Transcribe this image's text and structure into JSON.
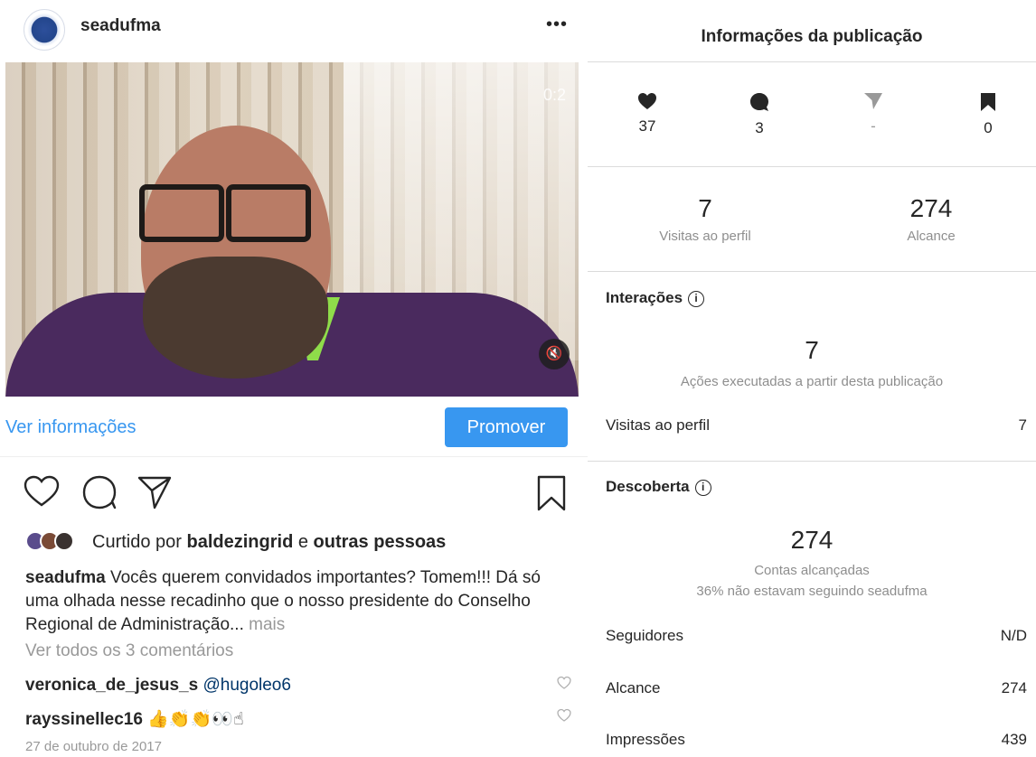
{
  "post": {
    "username": "seadufma",
    "more_label": "•••",
    "video_timer": "0:2",
    "mute_icon": "speaker-muted-icon",
    "view_info": "Ver informações",
    "promote": "Promover",
    "liked_prefix": "Curtido por ",
    "liked_user": "baldezingrid",
    "liked_mid": " e ",
    "liked_others": "outras pessoas",
    "caption_user": "seadufma",
    "caption_text": " Vocês querem convidados importantes? Tomem!!! Dá só uma olhada nesse recadinho que o nosso presidente do Conselho Regional de Administração...",
    "caption_more": " mais",
    "view_comments": "Ver todos os 3 comentários",
    "comments": [
      {
        "user": "veronica_de_jesus_s",
        "text": "@hugoleo6"
      },
      {
        "user": "rayssinellec16",
        "text": "👍👏👏👀☝"
      }
    ],
    "date": "27 de outubro de 2017"
  },
  "insights": {
    "title": "Informações da publicação",
    "stats": [
      {
        "icon": "heart-icon",
        "value": "37"
      },
      {
        "icon": "comment-icon",
        "value": "3"
      },
      {
        "icon": "share-icon",
        "value": "-"
      },
      {
        "icon": "bookmark-icon",
        "value": "0"
      }
    ],
    "profile_visits": {
      "value": "7",
      "label": "Visitas ao perfil"
    },
    "reach": {
      "value": "274",
      "label": "Alcance"
    },
    "interactions": {
      "title": "Interações",
      "total": "7",
      "caption": "Ações executadas a partir desta publicação",
      "rows": [
        {
          "label": "Visitas ao perfil",
          "value": "7"
        }
      ]
    },
    "discovery": {
      "title": "Descoberta",
      "total": "274",
      "caption": "Contas alcançadas",
      "sub_caption": "36% não estavam seguindo seadufma",
      "rows": [
        {
          "label": "Seguidores",
          "value": "N/D"
        },
        {
          "label": "Alcance",
          "value": "274"
        },
        {
          "label": "Impressões",
          "value": "439"
        }
      ]
    }
  },
  "colors": {
    "link_blue": "#3897f0",
    "text": "#262626",
    "muted": "#8e8e8e",
    "divider": "#dbdbdb"
  }
}
